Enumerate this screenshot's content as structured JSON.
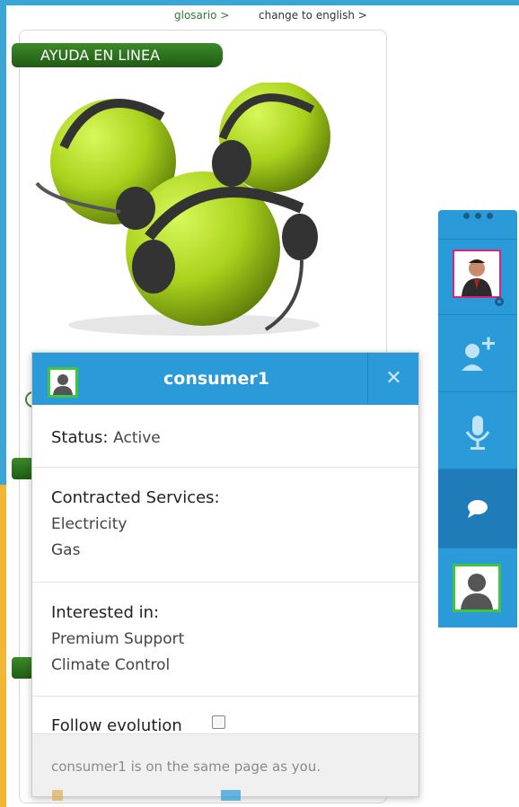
{
  "toplinks": {
    "glossary": "glosario >",
    "language": "change to english >"
  },
  "help_panel": {
    "ribbon_label": "AYUDA EN LINEA",
    "hero_image": "headset-balls-illustration"
  },
  "dock": {
    "agent_avatar": "agent-photo",
    "icons": [
      "gear-icon",
      "add-user-icon",
      "microphone-icon",
      "chat-icon",
      "user-icon"
    ]
  },
  "popup": {
    "username": "consumer1",
    "close_icon": "close-icon",
    "status": {
      "label": "Status:",
      "value": "Active"
    },
    "contracted": {
      "label": "Contracted Services:",
      "items": [
        "Electricity",
        "Gas"
      ]
    },
    "interested": {
      "label": "Interested in:",
      "items": [
        "Premium Support",
        "Climate Control"
      ]
    },
    "follow": {
      "label": "Follow evolution",
      "checked": false
    },
    "footer_message": "consumer1 is on the same page as you."
  },
  "colors": {
    "frame_blue": "#3aa6d6",
    "frame_yellow": "#f2b632",
    "dock_blue": "#2a9ad8",
    "ribbon_green": "#2f7a1f",
    "presence_green": "#3ec63e"
  }
}
